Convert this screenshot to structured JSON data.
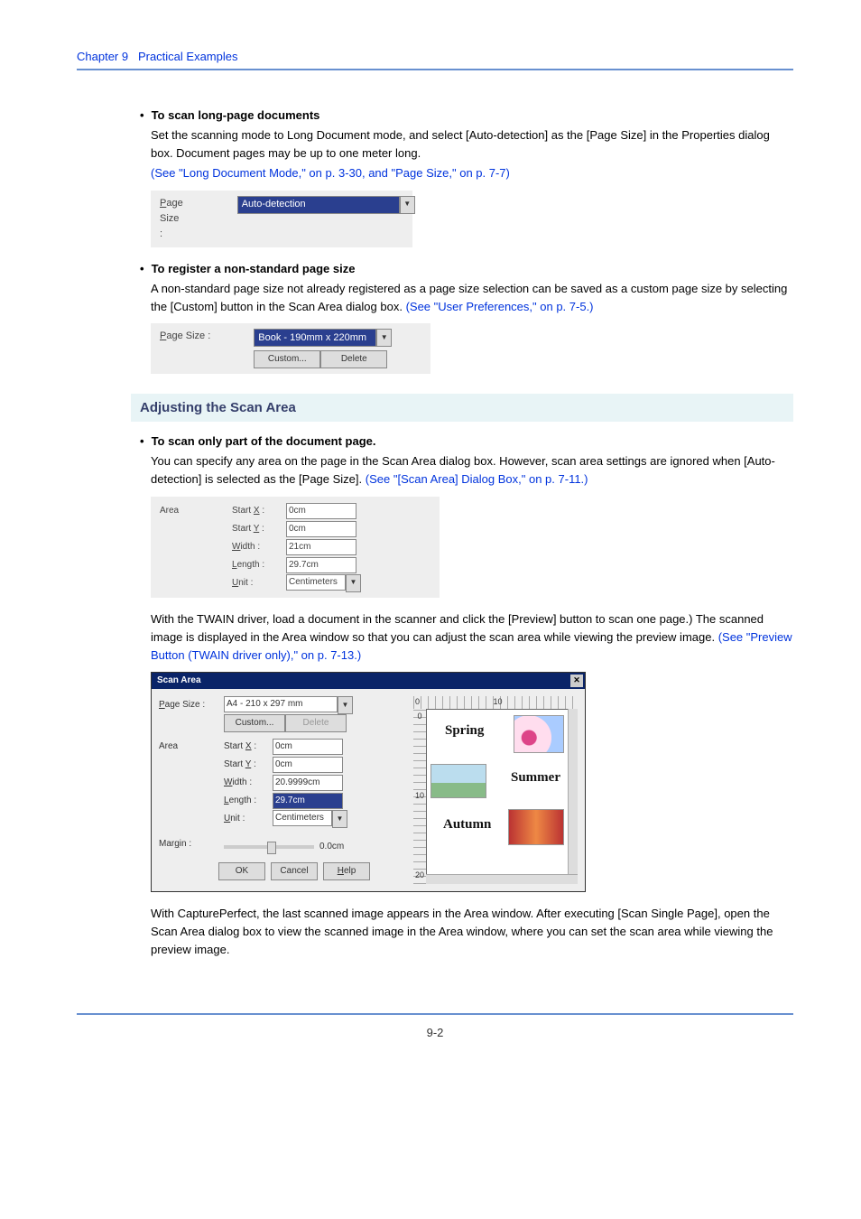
{
  "header": {
    "chapter": "Chapter 9",
    "title": "Practical Examples"
  },
  "long_doc": {
    "bullet": "To scan long-page documents",
    "text": "Set the scanning mode to Long Document mode, and select [Auto-detection] as the [Page Size] in the Properties dialog box. Document pages may be up to one meter long.",
    "link": "(See \"Long Document Mode,\" on p. 3-30, and \"Page Size,\" on p. 7-7)",
    "page_size_label": "Page Size :",
    "page_size_value": "Auto-detection"
  },
  "nonstd": {
    "bullet": "To register a non-standard page size",
    "text": "A non-standard page size not already registered as a page size selection can be saved as a custom page size by selecting the [Custom] button in the Scan Area dialog box. ",
    "link": "(See \"User Preferences,\" on p. 7-5.)",
    "page_size_label": "Page Size :",
    "page_size_value": "Book - 190mm x 220mm",
    "btn_custom": "Custom...",
    "btn_delete": "Delete"
  },
  "adjust_heading": "Adjusting the Scan Area",
  "scan_part": {
    "bullet": "To scan only part of the document page.",
    "text": "You can specify any area on the page in the Scan Area dialog box. However, scan area settings are ignored when [Auto-detection] is selected as the [Page Size]. ",
    "link": "(See \"[Scan Area] Dialog Box,\" on p. 7-11.)"
  },
  "area_fig": {
    "area_label": "Area",
    "start_x_label": "Start X :",
    "start_y_label": "Start Y :",
    "width_label": "Width :",
    "length_label": "Length :",
    "unit_label": "Unit :",
    "start_x": "0cm",
    "start_y": "0cm",
    "width": "21cm",
    "length": "29.7cm",
    "unit": "Centimeters"
  },
  "twain_para": "With the TWAIN driver, load a document in the scanner and click the [Preview] button to scan one page.) The scanned image is displayed in the Area window so that you can adjust the scan area while viewing the preview image. ",
  "twain_link": "(See \"Preview Button (TWAIN driver only),\" on p. 7-13.)",
  "dialog": {
    "title": "Scan Area",
    "close": "✕",
    "page_size_label": "Page Size :",
    "page_size_value": "A4 - 210 x 297 mm",
    "btn_custom": "Custom...",
    "btn_delete": "Delete",
    "area_label": "Area",
    "start_x_label": "Start X :",
    "start_y_label": "Start Y :",
    "width_label": "Width :",
    "length_label": "Length :",
    "unit_label": "Unit :",
    "start_x": "0cm",
    "start_y": "0cm",
    "width": "20.9999cm",
    "length": "29.7cm",
    "unit": "Centimeters",
    "margin_label": "Margin :",
    "margin_value": "0.0cm",
    "btn_ok": "OK",
    "btn_cancel": "Cancel",
    "btn_help": "Help",
    "ruler_h_0": "0",
    "ruler_h_10": "10",
    "ruler_v_0": "0",
    "ruler_v_10": "10",
    "ruler_v_20": "20",
    "season_spring": "Spring",
    "season_summer": "Summer",
    "season_autumn": "Autumn"
  },
  "capture_para": "With CapturePerfect, the last scanned image appears in the Area window. After executing [Scan Single Page], open the Scan Area dialog box to view the scanned image in the Area window, where you can set the scan area while viewing the preview image.",
  "footer": {
    "page_no": "9-2"
  }
}
